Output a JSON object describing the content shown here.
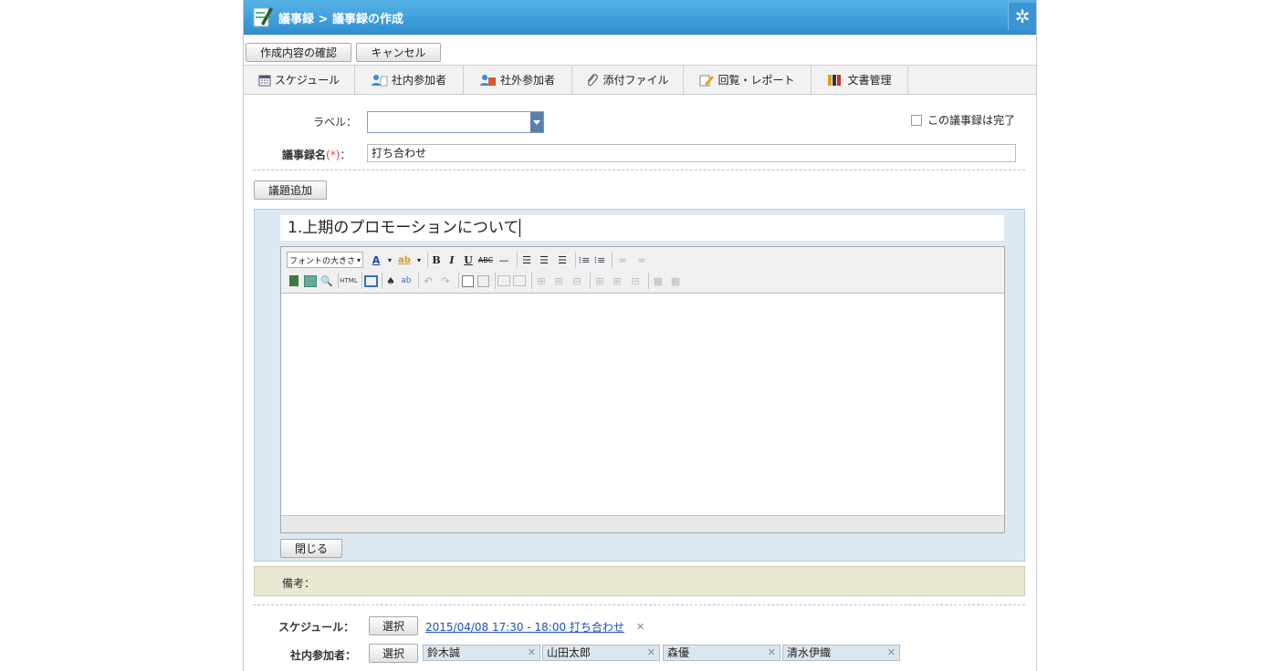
{
  "header": {
    "title": "議事録 > 議事録の作成"
  },
  "actions": {
    "confirm_label": "作成内容の確認",
    "cancel_label": "キャンセル"
  },
  "tabs": [
    {
      "label": "スケジュール",
      "icon": "calendar-icon"
    },
    {
      "label": "社内参加者",
      "icon": "internal-users-icon"
    },
    {
      "label": "社外参加者",
      "icon": "external-users-icon"
    },
    {
      "label": "添付ファイル",
      "icon": "paperclip-icon"
    },
    {
      "label": "回覧・レポート",
      "icon": "edit-note-icon"
    },
    {
      "label": "文書管理",
      "icon": "binder-icon"
    }
  ],
  "form": {
    "label_field": "ラベル：",
    "label_value": "",
    "complete_checkbox": "この議事録は完了",
    "name_field": "議事録名",
    "required_mark": "(*)",
    "name_colon": "：",
    "name_value": "打ち合わせ"
  },
  "agenda": {
    "add_button": "議題追加",
    "topic_title": "1.上期のプロモーションについて",
    "font_size_select": "フォントの大きさ",
    "close_button": "閉じる"
  },
  "memo": {
    "label": "備考："
  },
  "schedule": {
    "label": "スケジュール：",
    "select_button": "選択",
    "link_text": "2015/04/08 17:30 - 18:00 打ち合わせ"
  },
  "participants": {
    "label": "社内参加者：",
    "select_button": "選択",
    "people": [
      "鈴木誠",
      "山田太郎",
      "森優",
      "清水伊織"
    ]
  }
}
